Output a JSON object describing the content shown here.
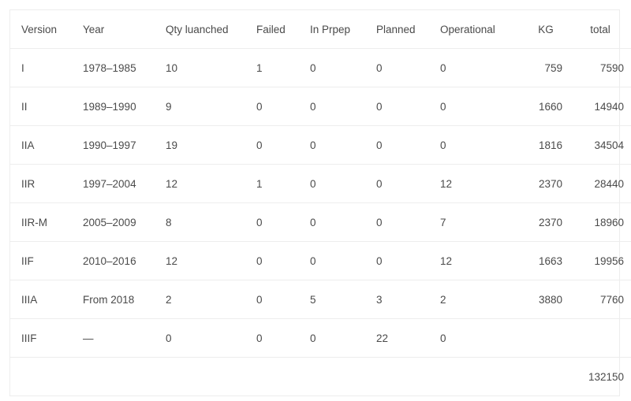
{
  "table": {
    "columns": [
      {
        "key": "version",
        "label": "Version"
      },
      {
        "key": "year",
        "label": "Year"
      },
      {
        "key": "qty",
        "label": "Qty luanched"
      },
      {
        "key": "failed",
        "label": "Failed"
      },
      {
        "key": "in_prep",
        "label": "In Prpep"
      },
      {
        "key": "planned",
        "label": "Planned"
      },
      {
        "key": "operational",
        "label": "Operational"
      },
      {
        "key": "kg",
        "label": "KG"
      },
      {
        "key": "total",
        "label": "total"
      }
    ],
    "rows": [
      {
        "version": "I",
        "year": "1978–1985",
        "qty": "10",
        "failed": "1",
        "in_prep": "0",
        "planned": "0",
        "operational": "0",
        "kg": "759",
        "total": "7590"
      },
      {
        "version": "II",
        "year": "1989–1990",
        "qty": "9",
        "failed": "0",
        "in_prep": "0",
        "planned": "0",
        "operational": "0",
        "kg": "1660",
        "total": "14940"
      },
      {
        "version": "IIA",
        "year": "1990–1997",
        "qty": "19",
        "failed": "0",
        "in_prep": "0",
        "planned": "0",
        "operational": "0",
        "kg": "1816",
        "total": "34504"
      },
      {
        "version": "IIR",
        "year": "1997–2004",
        "qty": "12",
        "failed": "1",
        "in_prep": "0",
        "planned": "0",
        "operational": "12",
        "kg": "2370",
        "total": "28440"
      },
      {
        "version": "IIR-M",
        "year": "2005–2009",
        "qty": "8",
        "failed": "0",
        "in_prep": "0",
        "planned": "0",
        "operational": "7",
        "kg": "2370",
        "total": "18960"
      },
      {
        "version": "IIF",
        "year": "2010–2016",
        "qty": "12",
        "failed": "0",
        "in_prep": "0",
        "planned": "0",
        "operational": "12",
        "kg": "1663",
        "total": "19956"
      },
      {
        "version": "IIIA",
        "year": "From 2018",
        "qty": "2",
        "failed": "0",
        "in_prep": "5",
        "planned": "3",
        "operational": "2",
        "kg": "3880",
        "total": "7760"
      },
      {
        "version": "IIIF",
        "year": "—",
        "qty": "0",
        "failed": "0",
        "in_prep": "0",
        "planned": "22",
        "operational": "0",
        "kg": "",
        "total": ""
      }
    ],
    "summary_row": {
      "version": "",
      "year": "",
      "qty": "",
      "failed": "",
      "in_prep": "",
      "planned": "",
      "operational": "",
      "kg": "",
      "total": "132150"
    }
  },
  "colors": {
    "text": "#4a4a4a",
    "border": "#ededed",
    "background": "#ffffff"
  }
}
